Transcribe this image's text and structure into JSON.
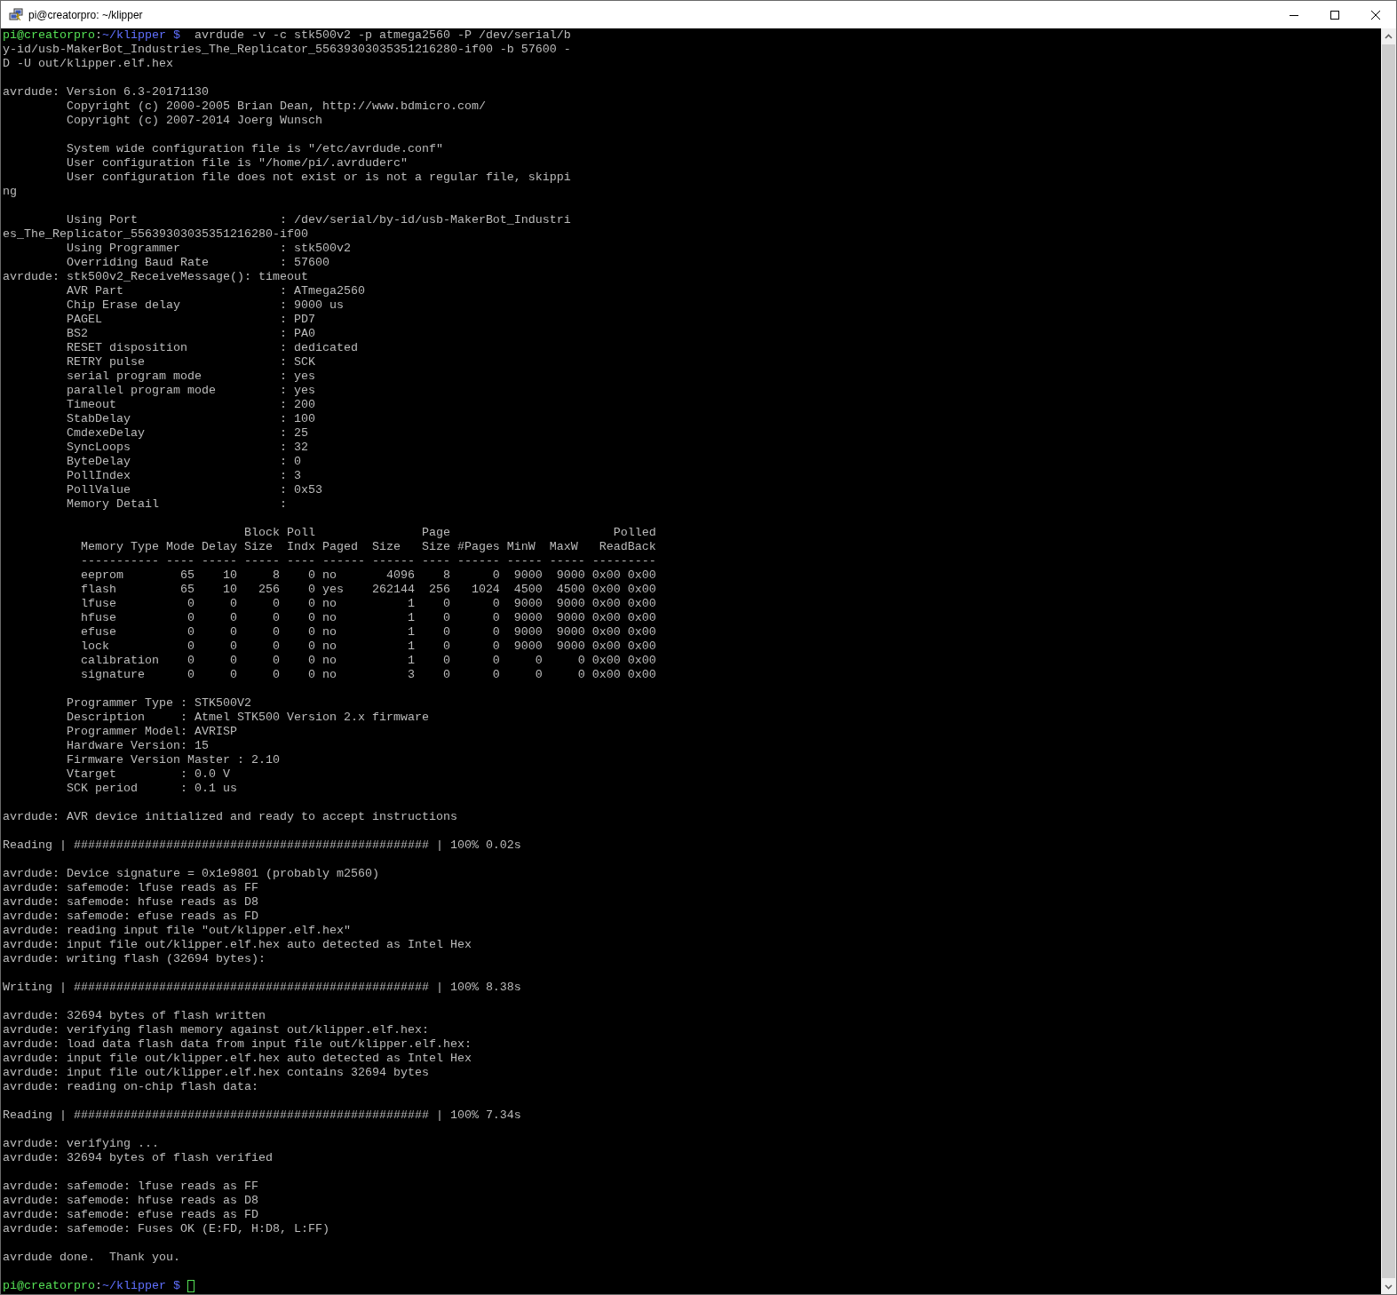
{
  "window": {
    "title": "pi@creatorpro: ~/klipper"
  },
  "terminal": {
    "blocks": [
      {
        "lines": [
          {
            "kind": "prompt",
            "host": "pi@creatorpro",
            "separator": ":",
            "path": "~/klipper $",
            "command": "avrdude -v -c stk500v2 -p atmega2560 -P /dev/serial/b"
          },
          {
            "kind": "text",
            "text": "y-id/usb-MakerBot_Industries_The_Replicator_55639303035351216280-if00 -b 57600 -"
          },
          {
            "kind": "text",
            "text": "D -U out/klipper.elf.hex"
          }
        ]
      },
      {
        "lines": [
          {
            "kind": "text",
            "text": "avrdude: Version 6.3-20171130"
          },
          {
            "kind": "text",
            "text": "         Copyright (c) 2000-2005 Brian Dean, http://www.bdmicro.com/"
          },
          {
            "kind": "text",
            "text": "         Copyright (c) 2007-2014 Joerg Wunsch"
          }
        ]
      },
      {
        "lines": [
          {
            "kind": "text",
            "text": "         System wide configuration file is \"/etc/avrdude.conf\""
          },
          {
            "kind": "text",
            "text": "         User configuration file is \"/home/pi/.avrduderc\""
          },
          {
            "kind": "text",
            "text": "         User configuration file does not exist or is not a regular file, skippi"
          },
          {
            "kind": "text",
            "text": "ng"
          }
        ]
      },
      {
        "lines": [
          {
            "kind": "text",
            "text": "         Using Port                    : /dev/serial/by-id/usb-MakerBot_Industri"
          },
          {
            "kind": "text",
            "text": "es_The_Replicator_55639303035351216280-if00"
          },
          {
            "kind": "text",
            "text": "         Using Programmer              : stk500v2"
          },
          {
            "kind": "text",
            "text": "         Overriding Baud Rate          : 57600"
          },
          {
            "kind": "text",
            "text": "avrdude: stk500v2_ReceiveMessage(): timeout"
          },
          {
            "kind": "text",
            "text": "         AVR Part                      : ATmega2560"
          },
          {
            "kind": "text",
            "text": "         Chip Erase delay              : 9000 us"
          },
          {
            "kind": "text",
            "text": "         PAGEL                         : PD7"
          },
          {
            "kind": "text",
            "text": "         BS2                           : PA0"
          },
          {
            "kind": "text",
            "text": "         RESET disposition             : dedicated"
          },
          {
            "kind": "text",
            "text": "         RETRY pulse                   : SCK"
          },
          {
            "kind": "text",
            "text": "         serial program mode           : yes"
          },
          {
            "kind": "text",
            "text": "         parallel program mode         : yes"
          },
          {
            "kind": "text",
            "text": "         Timeout                       : 200"
          },
          {
            "kind": "text",
            "text": "         StabDelay                     : 100"
          },
          {
            "kind": "text",
            "text": "         CmdexeDelay                   : 25"
          },
          {
            "kind": "text",
            "text": "         SyncLoops                     : 32"
          },
          {
            "kind": "text",
            "text": "         ByteDelay                     : 0"
          },
          {
            "kind": "text",
            "text": "         PollIndex                     : 3"
          },
          {
            "kind": "text",
            "text": "         PollValue                     : 0x53"
          },
          {
            "kind": "text",
            "text": "         Memory Detail                 :"
          }
        ]
      },
      {
        "lines": [
          {
            "kind": "text",
            "text": "                                  Block Poll               Page                       Polled"
          },
          {
            "kind": "text",
            "text": "           Memory Type Mode Delay Size  Indx Paged  Size   Size #Pages MinW  MaxW   ReadBack"
          },
          {
            "kind": "text",
            "text": "           ----------- ---- ----- ----- ---- ------ ------ ---- ------ ----- ----- ---------"
          },
          {
            "kind": "text",
            "text": "           eeprom        65    10     8    0 no       4096    8      0  9000  9000 0x00 0x00"
          },
          {
            "kind": "text",
            "text": "           flash         65    10   256    0 yes    262144  256   1024  4500  4500 0x00 0x00"
          },
          {
            "kind": "text",
            "text": "           lfuse          0     0     0    0 no          1    0      0  9000  9000 0x00 0x00"
          },
          {
            "kind": "text",
            "text": "           hfuse          0     0     0    0 no          1    0      0  9000  9000 0x00 0x00"
          },
          {
            "kind": "text",
            "text": "           efuse          0     0     0    0 no          1    0      0  9000  9000 0x00 0x00"
          },
          {
            "kind": "text",
            "text": "           lock           0     0     0    0 no          1    0      0  9000  9000 0x00 0x00"
          },
          {
            "kind": "text",
            "text": "           calibration    0     0     0    0 no          1    0      0     0     0 0x00 0x00"
          },
          {
            "kind": "text",
            "text": "           signature      0     0     0    0 no          3    0      0     0     0 0x00 0x00"
          }
        ]
      },
      {
        "lines": [
          {
            "kind": "text",
            "text": "         Programmer Type : STK500V2"
          },
          {
            "kind": "text",
            "text": "         Description     : Atmel STK500 Version 2.x firmware"
          },
          {
            "kind": "text",
            "text": "         Programmer Model: AVRISP"
          },
          {
            "kind": "text",
            "text": "         Hardware Version: 15"
          },
          {
            "kind": "text",
            "text": "         Firmware Version Master : 2.10"
          },
          {
            "kind": "text",
            "text": "         Vtarget         : 0.0 V"
          },
          {
            "kind": "text",
            "text": "         SCK period      : 0.1 us"
          }
        ]
      },
      {
        "lines": [
          {
            "kind": "text",
            "text": "avrdude: AVR device initialized and ready to accept instructions"
          }
        ]
      },
      {
        "lines": [
          {
            "kind": "text",
            "text": "Reading | ################################################## | 100% 0.02s"
          }
        ]
      },
      {
        "lines": [
          {
            "kind": "text",
            "text": "avrdude: Device signature = 0x1e9801 (probably m2560)"
          },
          {
            "kind": "text",
            "text": "avrdude: safemode: lfuse reads as FF"
          },
          {
            "kind": "text",
            "text": "avrdude: safemode: hfuse reads as D8"
          },
          {
            "kind": "text",
            "text": "avrdude: safemode: efuse reads as FD"
          },
          {
            "kind": "text",
            "text": "avrdude: reading input file \"out/klipper.elf.hex\""
          },
          {
            "kind": "text",
            "text": "avrdude: input file out/klipper.elf.hex auto detected as Intel Hex"
          },
          {
            "kind": "text",
            "text": "avrdude: writing flash (32694 bytes):"
          }
        ]
      },
      {
        "lines": [
          {
            "kind": "text",
            "text": "Writing | ################################################## | 100% 8.38s"
          }
        ]
      },
      {
        "lines": [
          {
            "kind": "text",
            "text": "avrdude: 32694 bytes of flash written"
          },
          {
            "kind": "text",
            "text": "avrdude: verifying flash memory against out/klipper.elf.hex:"
          },
          {
            "kind": "text",
            "text": "avrdude: load data flash data from input file out/klipper.elf.hex:"
          },
          {
            "kind": "text",
            "text": "avrdude: input file out/klipper.elf.hex auto detected as Intel Hex"
          },
          {
            "kind": "text",
            "text": "avrdude: input file out/klipper.elf.hex contains 32694 bytes"
          },
          {
            "kind": "text",
            "text": "avrdude: reading on-chip flash data:"
          }
        ]
      },
      {
        "lines": [
          {
            "kind": "text",
            "text": "Reading | ################################################## | 100% 7.34s"
          }
        ]
      },
      {
        "lines": [
          {
            "kind": "text",
            "text": "avrdude: verifying ..."
          },
          {
            "kind": "text",
            "text": "avrdude: 32694 bytes of flash verified"
          }
        ]
      },
      {
        "lines": [
          {
            "kind": "text",
            "text": "avrdude: safemode: lfuse reads as FF"
          },
          {
            "kind": "text",
            "text": "avrdude: safemode: hfuse reads as D8"
          },
          {
            "kind": "text",
            "text": "avrdude: safemode: efuse reads as FD"
          },
          {
            "kind": "text",
            "text": "avrdude: safemode: Fuses OK (E:FD, H:D8, L:FF)"
          }
        ]
      },
      {
        "lines": [
          {
            "kind": "text",
            "text": "avrdude done.  Thank you."
          }
        ]
      },
      {
        "lines": [
          {
            "kind": "prompt",
            "host": "pi@creatorpro",
            "separator": ":",
            "path": "~/klipper $",
            "cursor": true
          }
        ]
      }
    ]
  }
}
